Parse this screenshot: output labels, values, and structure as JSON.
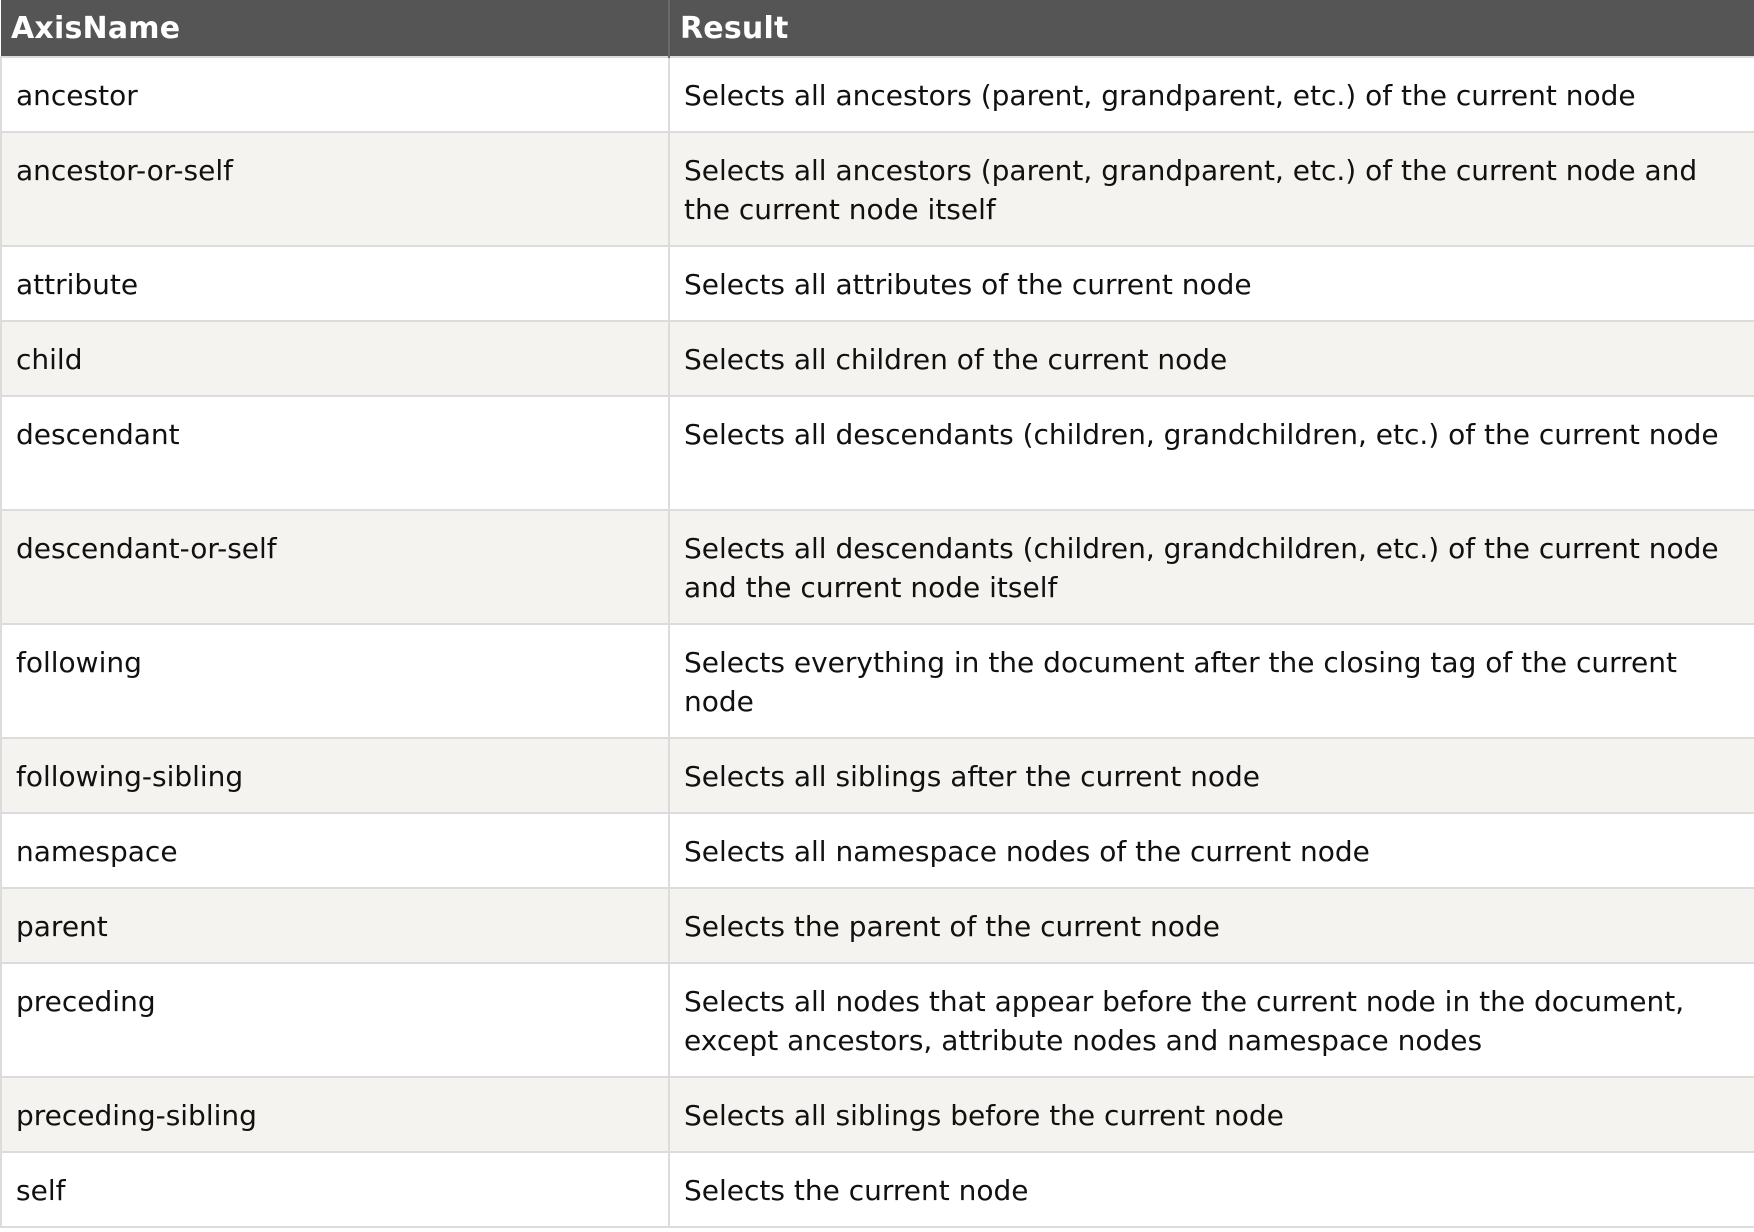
{
  "table": {
    "headers": [
      "AxisName",
      "Result"
    ],
    "rows": [
      {
        "axis": "ancestor",
        "result": "Selects all ancestors (parent, grandparent, etc.) of the current node"
      },
      {
        "axis": "ancestor-or-self",
        "result": "Selects all ancestors (parent, grandparent, etc.) of the current node and the current node itself"
      },
      {
        "axis": "attribute",
        "result": "Selects all attributes of the current node"
      },
      {
        "axis": "child",
        "result": "Selects all children of the current node"
      },
      {
        "axis": "descendant",
        "result": "Selects all descendants (children, grandchildren, etc.) of the current node"
      },
      {
        "axis": "descendant-or-self",
        "result": "Selects all descendants (children, grandchildren, etc.) of the current node and the current node itself"
      },
      {
        "axis": "following",
        "result": "Selects everything in the document after the closing tag of the current node"
      },
      {
        "axis": "following-sibling",
        "result": "Selects all siblings after the current node"
      },
      {
        "axis": "namespace",
        "result": "Selects all namespace nodes of the current node"
      },
      {
        "axis": "parent",
        "result": "Selects the parent of the current node"
      },
      {
        "axis": "preceding",
        "result": "Selects all nodes that appear before the current node in the document, except ancestors, attribute nodes and namespace nodes"
      },
      {
        "axis": "preceding-sibling",
        "result": "Selects all siblings before the current node"
      },
      {
        "axis": "self",
        "result": "Selects the current node"
      }
    ]
  },
  "colors": {
    "header_bg": "#555555",
    "header_text": "#ffffff",
    "row_alt_bg": "#f4f3ef",
    "border": "#dcdcdc"
  }
}
